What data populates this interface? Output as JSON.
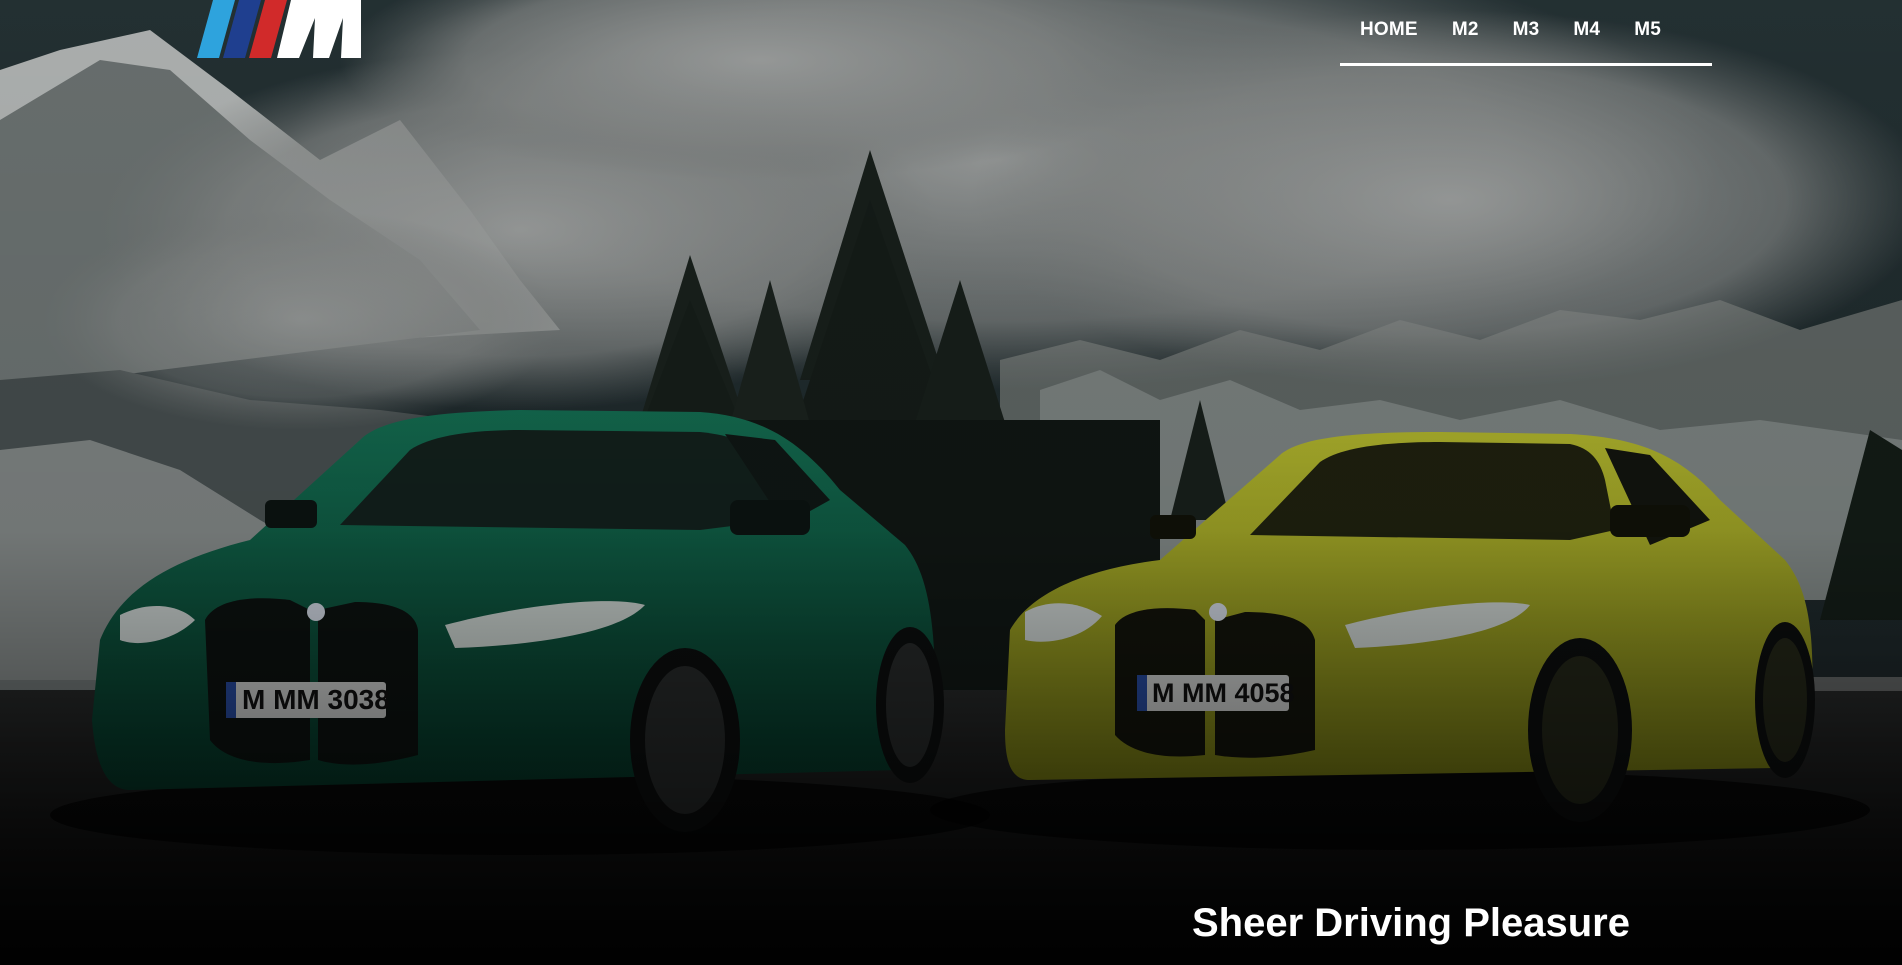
{
  "header": {
    "logo_icon": "bmw-m-logo-icon",
    "nav": [
      {
        "label": "HOME"
      },
      {
        "label": "M2"
      },
      {
        "label": "M3"
      },
      {
        "label": "M4"
      },
      {
        "label": "M5"
      }
    ]
  },
  "hero": {
    "background": "alpine-mountains-with-clouds",
    "tagline": {
      "light": "Sheer Driving ",
      "bold": "Pleasure"
    },
    "cars": [
      {
        "color": "green",
        "plate": "M MM 3038"
      },
      {
        "color": "yellow",
        "plate": "M MM 4058"
      }
    ]
  },
  "colors": {
    "text": "#ffffff",
    "m_light_blue": "#2ea3dd",
    "m_dark_blue": "#1f3f8f",
    "m_red": "#d12a2a",
    "green_car": "#0c5b43",
    "yellow_car": "#b6bb23"
  }
}
